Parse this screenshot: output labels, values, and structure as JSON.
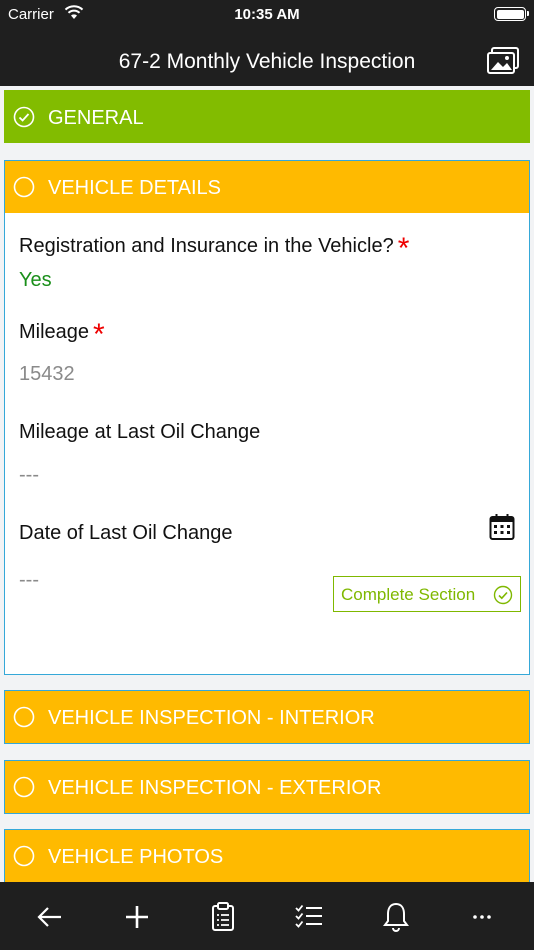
{
  "status_bar": {
    "carrier": "Carrier",
    "time": "10:35 AM"
  },
  "nav": {
    "title": "67-2 Monthly Vehicle Inspection",
    "gallery_icon": "image-gallery-icon"
  },
  "sections": {
    "general": {
      "title": "GENERAL",
      "color": "#82bc00",
      "status": "complete"
    },
    "vehicle_details": {
      "title": "VEHICLE DETAILS",
      "color": "#ffba00",
      "fields": {
        "registration": {
          "label": "Registration and Insurance in the Vehicle?",
          "required_mark": "*",
          "value": "Yes"
        },
        "mileage": {
          "label": "Mileage",
          "required_mark": "*",
          "value": "15432"
        },
        "mileage_last_oil": {
          "label": "Mileage at Last Oil Change",
          "value": "---"
        },
        "date_last_oil": {
          "label": "Date of Last Oil Change",
          "value": "---"
        }
      },
      "complete_button": "Complete Section"
    },
    "interior": {
      "title": "VEHICLE INSPECTION - INTERIOR",
      "color": "#ffba00"
    },
    "exterior": {
      "title": "VEHICLE INSPECTION - EXTERIOR",
      "color": "#ffba00"
    },
    "photos": {
      "title": "VEHICLE PHOTOS",
      "color": "#ffba00"
    }
  },
  "tab_bar": {
    "icons": [
      "back-arrow-icon",
      "plus-icon",
      "clipboard-icon",
      "checklist-icon",
      "bell-icon",
      "more-icon"
    ]
  }
}
